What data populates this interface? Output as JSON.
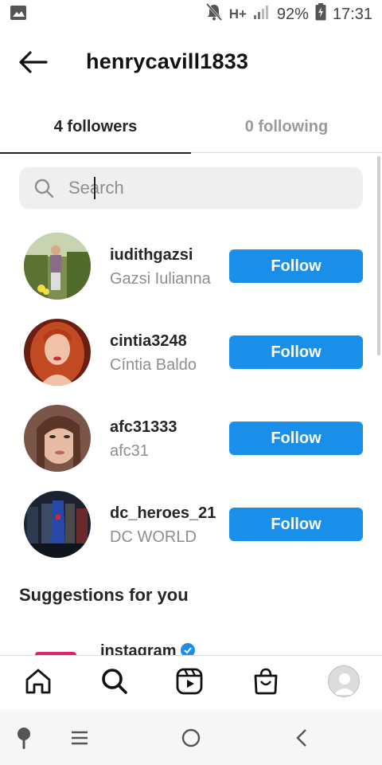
{
  "status_bar": {
    "network": "H+",
    "battery": "92%",
    "time": "17:31"
  },
  "header": {
    "title": "henrycavill1833",
    "back_icon": "arrow-left-icon"
  },
  "tabs": [
    {
      "label": "4 followers",
      "active": true
    },
    {
      "label": "0 following",
      "active": false
    }
  ],
  "search": {
    "placeholder": "Search",
    "value": ""
  },
  "followers": [
    {
      "username": "iudithgazsi",
      "full_name": "Gazsi Iulianna",
      "button": "Follow"
    },
    {
      "username": "cintia3248",
      "full_name": "Cíntia Baldo",
      "button": "Follow"
    },
    {
      "username": "afc31333",
      "full_name": "afc31",
      "button": "Follow"
    },
    {
      "username": "dc_heroes_21",
      "full_name": "DC WORLD",
      "button": "Follow"
    }
  ],
  "suggestions": {
    "title": "Suggestions for you",
    "first_username": "instagram"
  },
  "bottom_nav": [
    "home-icon",
    "search-icon",
    "reels-icon",
    "shop-icon",
    "profile-icon"
  ],
  "colors": {
    "accent": "#1a8fea",
    "text_primary": "#262626",
    "text_secondary": "#8e8e8e"
  }
}
